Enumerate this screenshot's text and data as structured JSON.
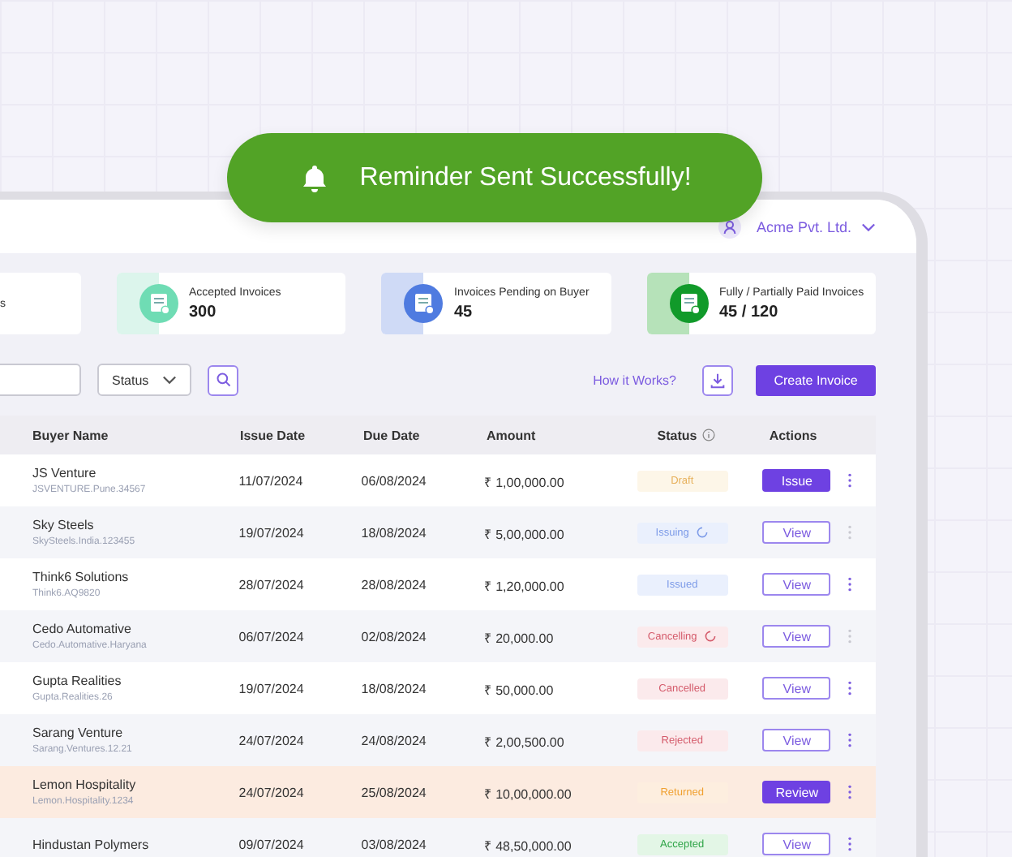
{
  "toast": {
    "text": "Reminder Sent Successfully!"
  },
  "header": {
    "account": "Acme Pvt. Ltd."
  },
  "cards": [
    {
      "label": "s",
      "kind": "total"
    },
    {
      "label": "Accepted Invoices",
      "value": "300",
      "kind": "accepted"
    },
    {
      "label": "Invoices Pending on Buyer",
      "value": "45",
      "kind": "pending"
    },
    {
      "label": "Fully / Partially Paid Invoices",
      "value": "45 / 120",
      "kind": "paid"
    }
  ],
  "toolbar": {
    "status_filter": "Status",
    "help_link": "How it Works?",
    "create_button": "Create Invoice"
  },
  "table": {
    "columns": [
      "Buyer Name",
      "Issue Date",
      "Due Date",
      "Amount",
      "Status",
      "Actions"
    ],
    "rows": [
      {
        "buyer": "JS Venture",
        "buyer_id": "JSVENTURE.Pune.34567",
        "issue": "11/07/2024",
        "due": "06/08/2024",
        "amount": "₹ 1,00,000.00",
        "status": "Draft",
        "kind": "draft",
        "loading": false,
        "action": "Issue",
        "action_primary": true,
        "menu_disabled": false,
        "highlighted": false
      },
      {
        "buyer": "Sky Steels",
        "buyer_id": "SkySteels.India.123455",
        "issue": "19/07/2024",
        "due": "18/08/2024",
        "amount": "₹ 5,00,000.00",
        "status": "Issuing",
        "kind": "issued",
        "loading": true,
        "action": "View",
        "action_primary": false,
        "menu_disabled": true,
        "highlighted": false
      },
      {
        "buyer": "Think6 Solutions",
        "buyer_id": "Think6.AQ9820",
        "issue": "28/07/2024",
        "due": "28/08/2024",
        "amount": "₹ 1,20,000.00",
        "status": "Issued",
        "kind": "issued",
        "loading": false,
        "action": "View",
        "action_primary": false,
        "menu_disabled": false,
        "highlighted": false
      },
      {
        "buyer": "Cedo Automative",
        "buyer_id": "Cedo.Automative.Haryana",
        "issue": "06/07/2024",
        "due": "02/08/2024",
        "amount": "₹ 20,000.00",
        "status": "Cancelling",
        "kind": "cancelled",
        "loading": true,
        "action": "View",
        "action_primary": false,
        "menu_disabled": true,
        "highlighted": false
      },
      {
        "buyer": "Gupta Realities",
        "buyer_id": "Gupta.Realities.26",
        "issue": "19/07/2024",
        "due": "18/08/2024",
        "amount": "₹ 50,000.00",
        "status": "Cancelled",
        "kind": "cancelled",
        "loading": false,
        "action": "View",
        "action_primary": false,
        "menu_disabled": false,
        "highlighted": false
      },
      {
        "buyer": "Sarang Venture",
        "buyer_id": "Sarang.Ventures.12.21",
        "issue": "24/07/2024",
        "due": "24/08/2024",
        "amount": "₹ 2,00,500.00",
        "status": "Rejected",
        "kind": "cancelled",
        "loading": false,
        "action": "View",
        "action_primary": false,
        "menu_disabled": false,
        "highlighted": false
      },
      {
        "buyer": "Lemon Hospitality",
        "buyer_id": "Lemon.Hospitality.1234",
        "issue": "24/07/2024",
        "due": "25/08/2024",
        "amount": "₹ 10,00,000.00",
        "status": "Returned",
        "kind": "returned",
        "loading": false,
        "action": "Review",
        "action_primary": true,
        "menu_disabled": false,
        "highlighted": true
      },
      {
        "buyer": "Hindustan Polymers",
        "issue": "09/07/2024",
        "due": "03/08/2024",
        "amount": "₹ 48,50,000.00",
        "status": "Accepted",
        "kind": "accepted",
        "loading": false,
        "action": "View",
        "action_primary": false,
        "menu_disabled": false,
        "highlighted": false
      }
    ]
  }
}
